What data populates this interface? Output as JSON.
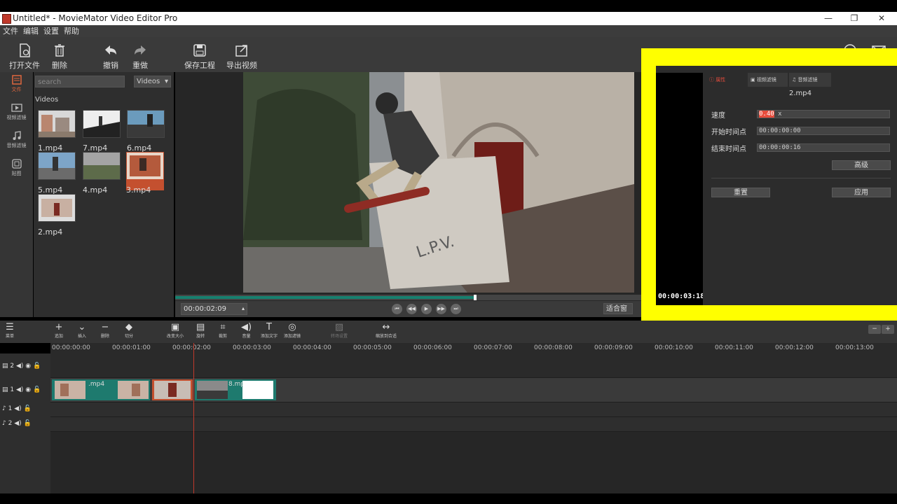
{
  "window": {
    "title": "Untitled* - MovieMator Video Editor Pro"
  },
  "menu": [
    "文件",
    "编辑",
    "设置",
    "帮助"
  ],
  "toolbar": {
    "open": "打开文件",
    "delete": "删除",
    "undo": "撤销",
    "redo": "重做",
    "save": "保存工程",
    "export": "导出视频",
    "tutorial": "教程",
    "feedback": "反馈"
  },
  "leftnav": [
    "文件",
    "视频滤镜",
    "音频滤镜",
    "贴图"
  ],
  "media": {
    "search_placeholder": "search",
    "filter": "Videos",
    "section": "Videos",
    "items": [
      {
        "label": "1.mp4",
        "selected": false
      },
      {
        "label": "7.mp4",
        "selected": false
      },
      {
        "label": "6.mp4",
        "selected": false
      },
      {
        "label": "5.mp4",
        "selected": false
      },
      {
        "label": "4.mp4",
        "selected": false
      },
      {
        "label": "3.mp4",
        "selected": true
      },
      {
        "label": "2.mp4",
        "selected": false
      }
    ]
  },
  "player": {
    "timecode": "00:00:02:09",
    "progress": 0.64,
    "zoom": "适合窗"
  },
  "properties": {
    "tabs": [
      "属性",
      "视频滤镜",
      "音频滤镜"
    ],
    "clip_name": "2.mp4",
    "speed_label": "速度",
    "speed_value": "0.40",
    "speed_unit": "x",
    "start_label": "开始时间点",
    "start_value": "00:00:00:00",
    "end_label": "结束时间点",
    "end_value": "00:00:00:16",
    "advanced": "高级",
    "reset": "重置",
    "apply": "应用",
    "overlay_time": "00:00:03:18"
  },
  "timeline_tools": [
    {
      "glyph": "☰",
      "label": "菜单"
    },
    {
      "glyph": "+",
      "label": "追加"
    },
    {
      "glyph": "⌄",
      "label": "插入"
    },
    {
      "glyph": "−",
      "label": "删除"
    },
    {
      "glyph": "◆",
      "label": "切分"
    },
    {
      "glyph": "▣",
      "label": "改变大小"
    },
    {
      "glyph": "▤",
      "label": "旋转"
    },
    {
      "glyph": "⌗",
      "label": "裁剪"
    },
    {
      "glyph": "◀)",
      "label": "音量"
    },
    {
      "glyph": "T",
      "label": "添加文字"
    },
    {
      "glyph": "◎",
      "label": "添加滤镜"
    },
    {
      "glyph": "▨",
      "label": "转场设置"
    },
    {
      "glyph": "↔",
      "label": "缩放到合适"
    }
  ],
  "ruler": [
    "00:00:00:00",
    "00:00:01:00",
    "00:00:02:00",
    "00:00:03:00",
    "00:00:04:00",
    "00:00:05:00",
    "00:00:06:00",
    "00:00:07:00",
    "00:00:08:00",
    "00:00:09:00",
    "00:00:10:00",
    "00:00:11:00",
    "00:00:12:00",
    "00:00:13:00"
  ],
  "tracks": [
    {
      "label": "2",
      "kind": "video"
    },
    {
      "label": "1",
      "kind": "video"
    },
    {
      "label": "1",
      "kind": "audio"
    },
    {
      "label": "2",
      "kind": "audio"
    }
  ],
  "clips": [
    {
      "label": ".mp4"
    },
    {
      "label": ""
    },
    {
      "label": "8.mp"
    }
  ],
  "colors": {
    "accent": "#c4502f",
    "clip": "#1e7a6e",
    "highlight": "#ffff00"
  }
}
